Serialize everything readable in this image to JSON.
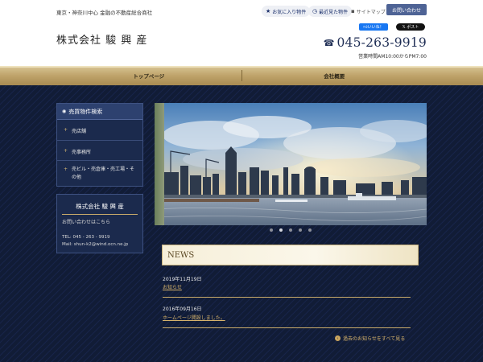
{
  "header": {
    "tagline": "東京・神奈川中心 金融の不動産総合商社",
    "logo": "株式会社 駿 興 産",
    "favorites_label": "お気に入り物件",
    "recent_label": "最近見た物件",
    "sitemap_label": "サイトマップ",
    "contact_label": "お問い合わせ",
    "like_label": "いいね！",
    "post_label": "ポスト",
    "phone": "045-263-9919",
    "hours": "営業時間AM10:00からPM7:00"
  },
  "nav": {
    "items": [
      {
        "label": "トップページ"
      },
      {
        "label": "会社概要"
      }
    ]
  },
  "sidebar": {
    "menu_title": "売買物件検索",
    "items": [
      {
        "label": "売店舗"
      },
      {
        "label": "売事務所"
      },
      {
        "label": "売ビル・売倉庫・売工場・その他"
      }
    ],
    "company": {
      "name": "株式会社 駿 興 産",
      "contact": "お問い合わせはこちら",
      "tel": "TEL: 045 - 263 - 9919",
      "mail": "Mail: shun-k2@wind.ocn.ne.jp"
    }
  },
  "slider": {
    "dot_count": 5,
    "active_index": 1
  },
  "news": {
    "title": "NEWS",
    "entries": [
      {
        "date": "2019年11月19日",
        "link": "お知らせ"
      },
      {
        "date": "2016年09月16日",
        "link": "ホームページ開設しました。"
      }
    ],
    "more_label": "過去のお知らせをすべて見る"
  },
  "colors": {
    "background": "#0f1a33",
    "gold": "#c9ab6a",
    "nav_gold": "#bfa36a",
    "sidebar_panel": "#1b2a4d",
    "contact_button": "#4e6395"
  },
  "icons": {
    "favorites": "star-icon",
    "recent": "clock-icon",
    "sitemap": "square-icon",
    "phone": "phone-icon",
    "menu_head": "search-icon",
    "more": "arrow-right-circle-icon"
  }
}
